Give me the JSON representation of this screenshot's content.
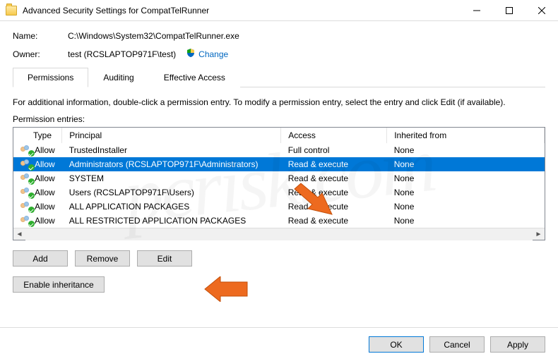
{
  "window": {
    "title": "Advanced Security Settings for CompatTelRunner"
  },
  "fields": {
    "name_label": "Name:",
    "name_value": "C:\\Windows\\System32\\CompatTelRunner.exe",
    "owner_label": "Owner:",
    "owner_value": "test (RCSLAPTOP971F\\test)",
    "change_link": "Change"
  },
  "tabs": {
    "permissions": "Permissions",
    "auditing": "Auditing",
    "effective": "Effective Access"
  },
  "info_text": "For additional information, double-click a permission entry. To modify a permission entry, select the entry and click Edit (if available).",
  "section_label": "Permission entries:",
  "columns": {
    "type": "Type",
    "principal": "Principal",
    "access": "Access",
    "inherited": "Inherited from"
  },
  "rows": [
    {
      "type": "Allow",
      "principal": "TrustedInstaller",
      "access": "Full control",
      "inherited": "None"
    },
    {
      "type": "Allow",
      "principal": "Administrators (RCSLAPTOP971F\\Administrators)",
      "access": "Read & execute",
      "inherited": "None"
    },
    {
      "type": "Allow",
      "principal": "SYSTEM",
      "access": "Read & execute",
      "inherited": "None"
    },
    {
      "type": "Allow",
      "principal": "Users (RCSLAPTOP971F\\Users)",
      "access": "Read & execute",
      "inherited": "None"
    },
    {
      "type": "Allow",
      "principal": "ALL APPLICATION PACKAGES",
      "access": "Read & execute",
      "inherited": "None"
    },
    {
      "type": "Allow",
      "principal": "ALL RESTRICTED APPLICATION PACKAGES",
      "access": "Read & execute",
      "inherited": "None"
    }
  ],
  "selected_row": 1,
  "buttons": {
    "add": "Add",
    "remove": "Remove",
    "edit": "Edit",
    "enable": "Enable inheritance",
    "ok": "OK",
    "cancel": "Cancel",
    "apply": "Apply"
  }
}
